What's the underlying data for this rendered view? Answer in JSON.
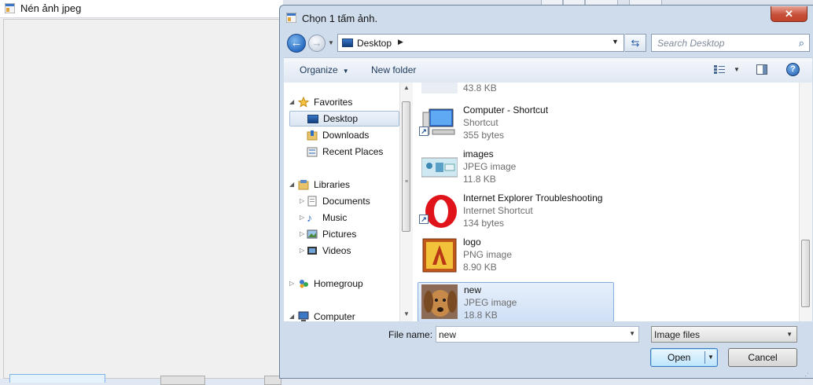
{
  "background_app": {
    "title": "Nén ảnh jpeg",
    "icon": "app-window-icon"
  },
  "dialog": {
    "title": "Chọn 1 tấm ảnh.",
    "close_label": "✕",
    "icons": {
      "title": "app-window-icon",
      "close": "close-icon"
    }
  },
  "nav": {
    "back_icon": "back-arrow-icon",
    "forward_icon": "forward-arrow-icon",
    "path": "Desktop",
    "refresh_icon": "refresh-icon",
    "search_placeholder": "Search Desktop",
    "search_icon": "search-icon"
  },
  "toolbar": {
    "organize": "Organize",
    "new_folder": "New folder",
    "views_icon": "views-icon",
    "preview_pane_icon": "preview-pane-icon",
    "help_label": "?"
  },
  "tree": {
    "favorites": "Favorites",
    "favorites_items": [
      "Desktop",
      "Downloads",
      "Recent Places"
    ],
    "libraries": "Libraries",
    "libraries_items": [
      "Documents",
      "Music",
      "Pictures",
      "Videos"
    ],
    "homegroup": "Homegroup",
    "computer": "Computer",
    "selected": "Desktop"
  },
  "files": {
    "partial_size": "43.8 KB",
    "items": [
      {
        "name": "Computer - Shortcut",
        "type": "Shortcut",
        "size": "355 bytes",
        "icon": "computer-shortcut-icon"
      },
      {
        "name": "images",
        "type": "JPEG image",
        "size": "11.8 KB",
        "icon": "image-thumbnail"
      },
      {
        "name": "Internet Explorer Troubleshooting",
        "type": "Internet Shortcut",
        "size": "134 bytes",
        "icon": "opera-browser-icon"
      },
      {
        "name": "logo",
        "type": "PNG image",
        "size": "8.90 KB",
        "icon": "logo-thumbnail"
      },
      {
        "name": "new",
        "type": "JPEG image",
        "size": "18.8 KB",
        "icon": "dog-photo-thumbnail"
      }
    ],
    "selected": "new"
  },
  "bottom": {
    "file_name_label": "File name:",
    "file_name_value": "new",
    "file_type_value": "Image files",
    "open_label": "Open",
    "cancel_label": "Cancel"
  },
  "colors": {
    "accent": "#3d7bbf",
    "selection": "#cfe0f6",
    "dialog_frame": "#cfdceb"
  }
}
